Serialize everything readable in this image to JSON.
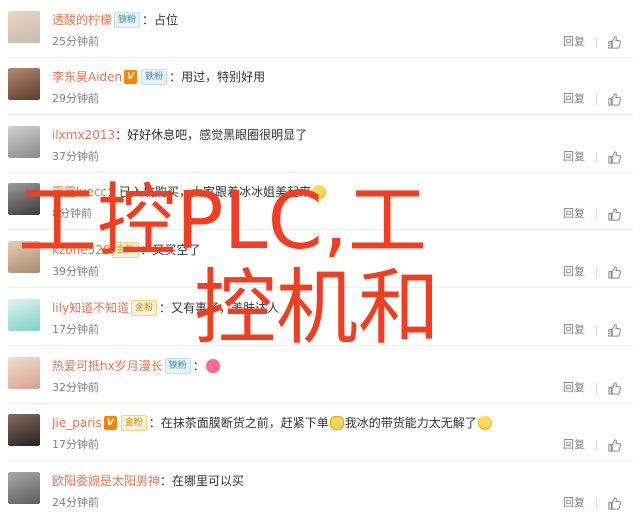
{
  "actions": {
    "reply": "回复",
    "like_icon": "thumbs-up-icon"
  },
  "colors": {
    "username": "#eb7350",
    "meta": "#808080",
    "watermark": "#ee3f22"
  },
  "comments": [
    {
      "username": "透酸的柠檬",
      "badges": [
        {
          "type": "fan",
          "text": "铁粉"
        }
      ],
      "content": "占位",
      "emojis": [],
      "time": "25分钟前",
      "avatar_colors": [
        "#c9b9a8",
        "#e8d8c6"
      ]
    },
    {
      "username": "李东昊Aiden",
      "badges": [
        {
          "type": "vip",
          "text": "V"
        },
        {
          "type": "fan",
          "text": "铁粉"
        }
      ],
      "content": "用过，特别好用",
      "emojis": [],
      "time": "29分钟前",
      "avatar_colors": [
        "#5a3c2e",
        "#b48a6a"
      ]
    },
    {
      "username": "ilxmx2013",
      "badges": [],
      "content": "好好休息吧，感觉黑眼圈很明显了",
      "emojis": [],
      "time": "37分钟前",
      "avatar_colors": [
        "#8a8a8a",
        "#d0d0d0"
      ]
    },
    {
      "username": "露露lvecc",
      "badges": [],
      "content": "已入坑购买，大家跟着冰冰姐美起来",
      "emojis": [
        "laugh-emoji"
      ],
      "time": "8分钟前",
      "avatar_colors": [
        "#3b3b3b",
        "#9b9b9b"
      ]
    },
    {
      "username": "kzone520",
      "badges": [
        {
          "type": "gold",
          "text": "金粉"
        }
      ],
      "content": "又买空了",
      "emojis": [],
      "time": "39分钟前",
      "avatar_colors": [
        "#a88a6f",
        "#e6cdb5"
      ]
    },
    {
      "username": "lily知道不知道",
      "badges": [
        {
          "type": "gold",
          "text": "金粉"
        }
      ],
      "content": "又有事了，美肤达人",
      "emojis": [],
      "time": "17分钟前",
      "avatar_colors": [
        "#7fd1c6",
        "#dff3f0"
      ]
    },
    {
      "username": "热爱可抵hx岁月漫长",
      "badges": [
        {
          "type": "fan",
          "text": "铁粉"
        }
      ],
      "content": "",
      "emojis": [
        "heart-emoji"
      ],
      "time": "32分钟前",
      "avatar_colors": [
        "#d4a48c",
        "#f2ddd2"
      ]
    },
    {
      "username": "Jie_paris",
      "badges": [
        {
          "type": "vip",
          "text": "V"
        },
        {
          "type": "gold",
          "text": "金粉"
        }
      ],
      "content": "在抹茶面膜断货之前，赶紧下单",
      "content2": "我冰的带货能力太无解了",
      "emojis": [
        "cat-emoji",
        "smile-emoji"
      ],
      "time": "17分钟前",
      "avatar_colors": [
        "#222222",
        "#8a6b5a"
      ]
    },
    {
      "username": "欧阳委婉是太阳男神",
      "badges": [],
      "content": "在哪里可以买",
      "emojis": [],
      "time": "24分钟前",
      "avatar_colors": [
        "#5b5b5b",
        "#aaaaaa"
      ]
    }
  ],
  "watermark": {
    "line1": "工控PLC,工",
    "line2": "控机和"
  }
}
